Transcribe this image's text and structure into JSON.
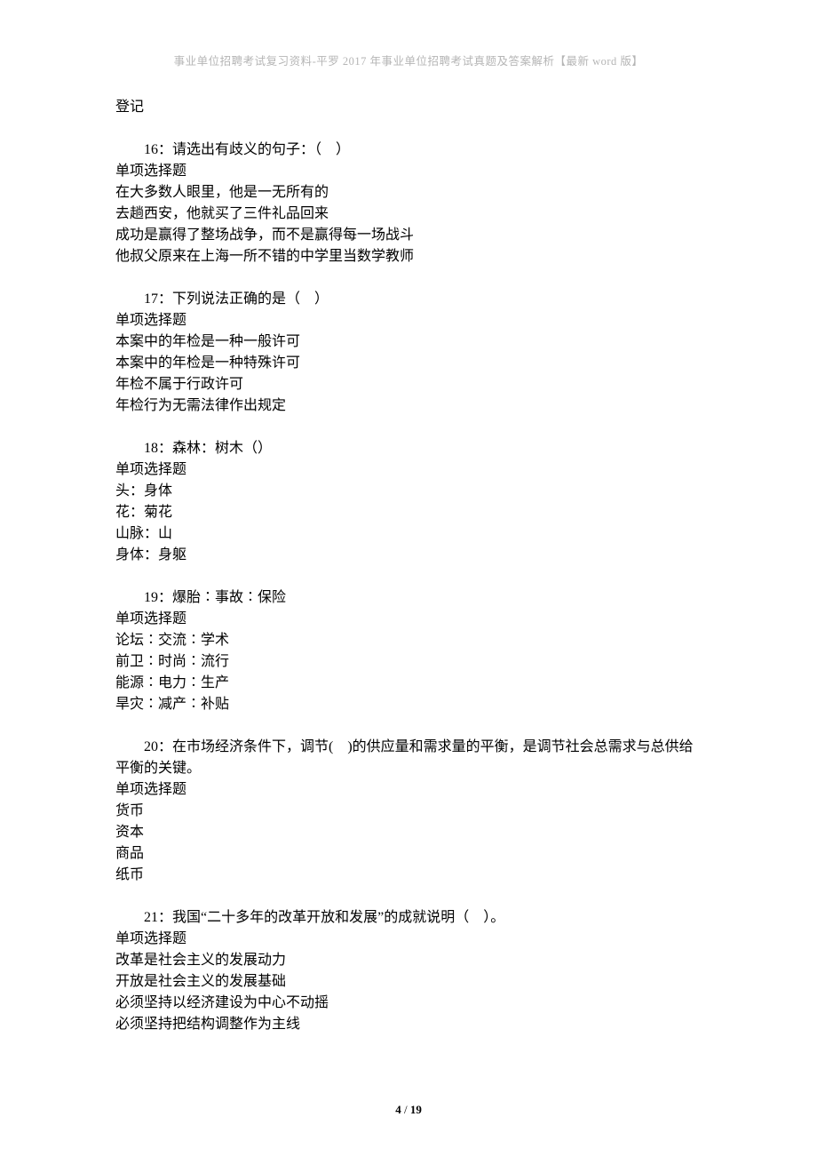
{
  "header_text": "事业单位招聘考试复习资料-平罗 2017 年事业单位招聘考试真题及答案解析【最新 word 版】",
  "orphan_line": "登记",
  "questions": [
    {
      "stem": "16：请选出有歧义的句子：（　）",
      "type": "单项选择题",
      "options": [
        "在大多数人眼里，他是一无所有的",
        "去趟西安，他就买了三件礼品回来",
        "成功是赢得了整场战争，而不是赢得每一场战斗",
        "他叔父原来在上海一所不错的中学里当数学教师"
      ]
    },
    {
      "stem": "17：下列说法正确的是（　）",
      "type": "单项选择题",
      "options": [
        "本案中的年检是一种一般许可",
        "本案中的年检是一种特殊许可",
        "年检不属于行政许可",
        "年检行为无需法律作出规定"
      ]
    },
    {
      "stem": "18：森林：树木（）",
      "type": "单项选择题",
      "options": [
        "头：身体",
        "花：菊花",
        "山脉：山",
        "身体：身躯"
      ]
    },
    {
      "stem": "19：爆胎∶事故∶保险",
      "type": "单项选择题",
      "options": [
        "论坛∶交流∶学术",
        "前卫∶时尚∶流行",
        "能源∶电力∶生产",
        "旱灾∶减产∶补贴"
      ]
    },
    {
      "stem": "20：在市场经济条件下，调节(　)的供应量和需求量的平衡，是调节社会总需求与总供给平衡的关键。",
      "type": "单项选择题",
      "options": [
        "货币",
        "资本",
        "商品",
        "纸币"
      ]
    },
    {
      "stem": "21：我国“二十多年的改革开放和发展”的成就说明（　）。",
      "type": "单项选择题",
      "options": [
        "改革是社会主义的发展动力",
        "开放是社会主义的发展基础",
        "必须坚持以经济建设为中心不动摇",
        "必须坚持把结构调整作为主线"
      ]
    }
  ],
  "footer": {
    "current_page": "4",
    "sep": " / ",
    "total_pages": "19"
  }
}
